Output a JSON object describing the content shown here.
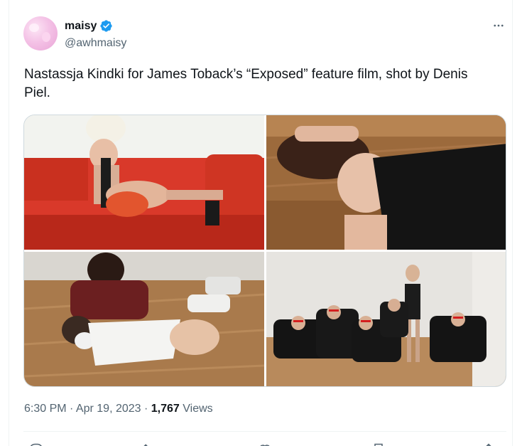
{
  "tweet": {
    "author": {
      "display_name": "maisy",
      "handle": "@awhmaisy",
      "verified": true
    },
    "text": "Nastassja Kindki for James Toback’s “Exposed” feature film, shot by Denis Piel.",
    "more_icon": "more-horizontal-icon",
    "timestamp": "6:30 PM · Apr 19, 2023 ·",
    "views_count": "1,767",
    "views_label": "Views",
    "media": [
      {
        "name": "woman-on-red-sofa-photo"
      },
      {
        "name": "woman-lying-on-floor-photo"
      },
      {
        "name": "two-women-on-wooden-floor-photo"
      },
      {
        "name": "woman-standing-among-men-in-tuxedos-photo"
      }
    ],
    "actions": [
      "reply-icon",
      "repost-icon",
      "like-icon",
      "bookmark-icon",
      "share-icon"
    ]
  },
  "colors": {
    "primary_text": "#0f1419",
    "secondary_text": "#536471",
    "verified_blue": "#1d9bf0",
    "border": "#cfd9de"
  }
}
